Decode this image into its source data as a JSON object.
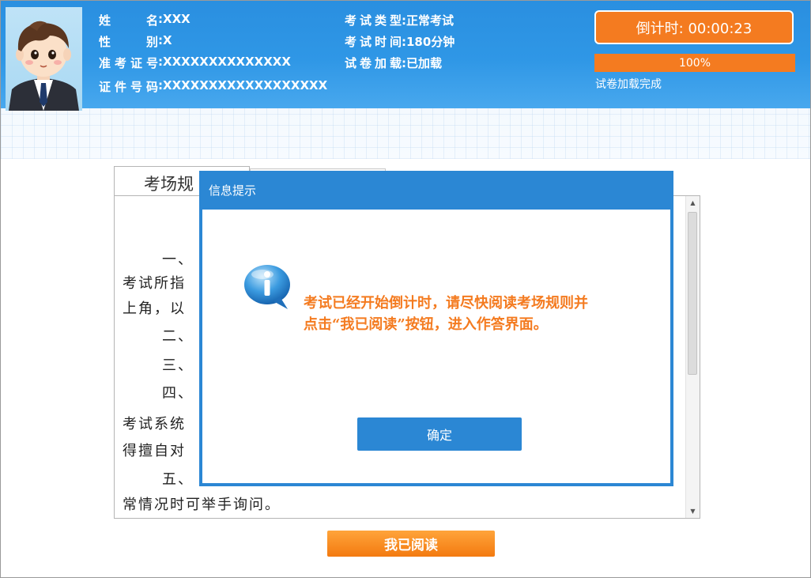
{
  "candidate": {
    "name_label": "姓 名",
    "name_value": "XXX",
    "gender_label": "性 别",
    "gender_value": "X",
    "ticket_label": "准考证号",
    "ticket_value": "XXXXXXXXXXXXXX",
    "id_label": "证件号码",
    "id_value": "XXXXXXXXXXXXXXXXXX"
  },
  "exam": {
    "type_label": "考试类型",
    "type_value": "正常考试",
    "time_label": "考试时间",
    "time_value": "180分钟",
    "load_label": "试卷加载",
    "load_value": "已加载"
  },
  "countdown": {
    "text": "倒计时: 00:00:23"
  },
  "progress": {
    "percent_text": "100%",
    "percent": 100,
    "caption": "试卷加载完成"
  },
  "rules": {
    "tab_label": "考场规",
    "lines": [
      "一、",
      "考试所指",
      "上角，以",
      "二、",
      "三、",
      "四、",
      "考试系统",
      "得擅自对",
      "五、",
      "常情况时可举手询问。"
    ]
  },
  "read_button": {
    "label": "我已阅读"
  },
  "dialog": {
    "title": "信息提示",
    "message_line1": "考试已经开始倒计时，请尽快阅读考场规则并",
    "message_line2": "点击“我已阅读”按钮，进入作答界面。",
    "ok_label": "确定",
    "icon": "info-bubble-icon"
  },
  "colors": {
    "header_blue": "#2f97e6",
    "accent_orange": "#f47b20",
    "dialog_blue": "#2b87d4"
  }
}
